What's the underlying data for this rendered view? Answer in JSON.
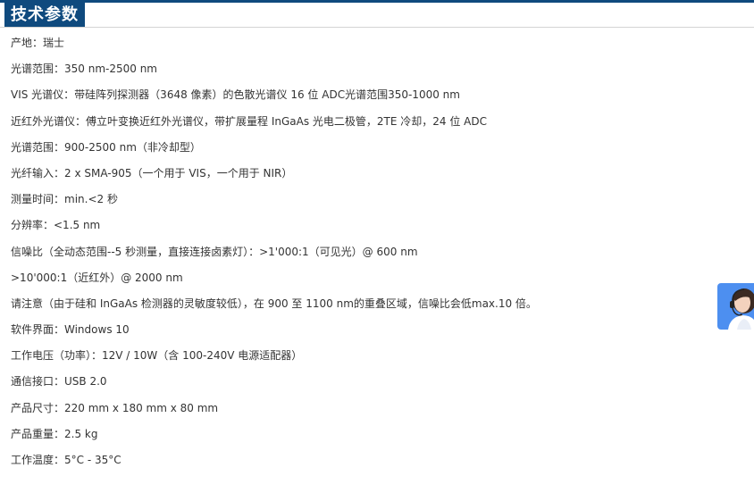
{
  "section": {
    "title": "技术参数"
  },
  "specs": [
    "产地：瑞士",
    "光谱范围：350 nm-2500 nm",
    "VIS 光谱仪：带硅阵列探测器（3648 像素）的色散光谱仪 16 位 ADC光谱范围350-1000 nm",
    "近红外光谱仪：傅立叶变换近红外光谱仪，带扩展量程 InGaAs 光电二极管，2TE 冷却，24 位 ADC",
    "光谱范围：900-2500 nm（非冷却型）",
    "光纤输入：2 x SMA-905（一个用于 VIS，一个用于 NIR）",
    "测量时间：min.<2 秒",
    "分辨率：<1.5 nm",
    "信噪比（全动态范围--5 秒测量，直接连接卤素灯）：>1'000:1（可见光）@ 600 nm",
    ">10'000:1（近红外）@ 2000 nm",
    "请注意（由于硅和 InGaAs 检测器的灵敏度较低），在 900 至 1100 nm的重叠区域，信噪比会低max.10 倍。",
    "软件界面：Windows 10",
    "工作电压（功率）：12V / 10W（含 100-240V 电源适配器）",
    "通信接口：USB 2.0",
    "产品尺寸：220 mm x 180 mm x 80 mm",
    "产品重量：2.5 kg",
    "工作温度：5°C - 35°C"
  ],
  "widget": {
    "icon": "customer-service-icon",
    "color": "#4d8ff0"
  }
}
